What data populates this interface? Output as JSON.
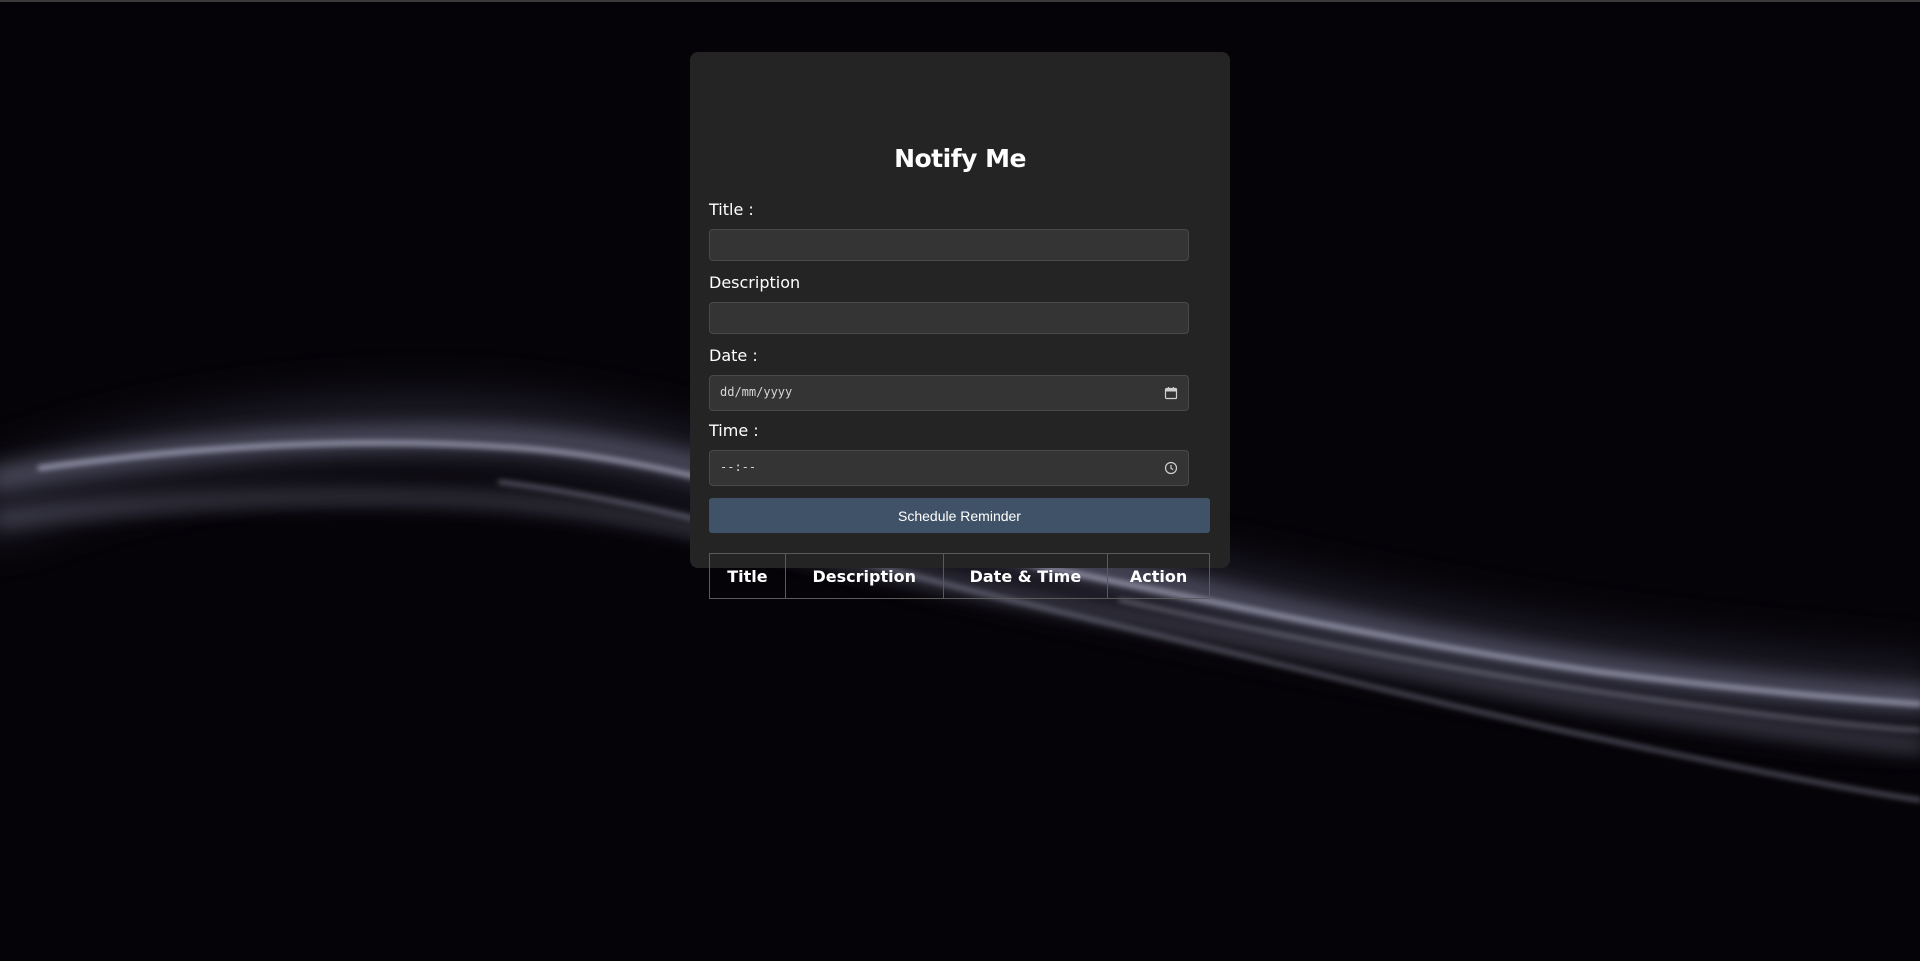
{
  "app": {
    "heading": "Notify Me"
  },
  "form": {
    "title_label": "Title :",
    "title_value": "",
    "description_label": "Description",
    "description_value": "",
    "date_label": "Date :",
    "date_placeholder": "dd/mm/yyyy",
    "time_label": "Time :",
    "time_placeholder": "--:--",
    "submit_label": "Schedule Reminder"
  },
  "table": {
    "headers": [
      "Title",
      "Description",
      "Date & Time",
      "Action"
    ],
    "rows": []
  },
  "icons": {
    "date_picker": "calendar-icon",
    "time_picker": "clock-icon"
  },
  "colors": {
    "background": "#050307",
    "card": "#242424",
    "input": "#343434",
    "button": "#405267",
    "text": "#ffffff"
  }
}
